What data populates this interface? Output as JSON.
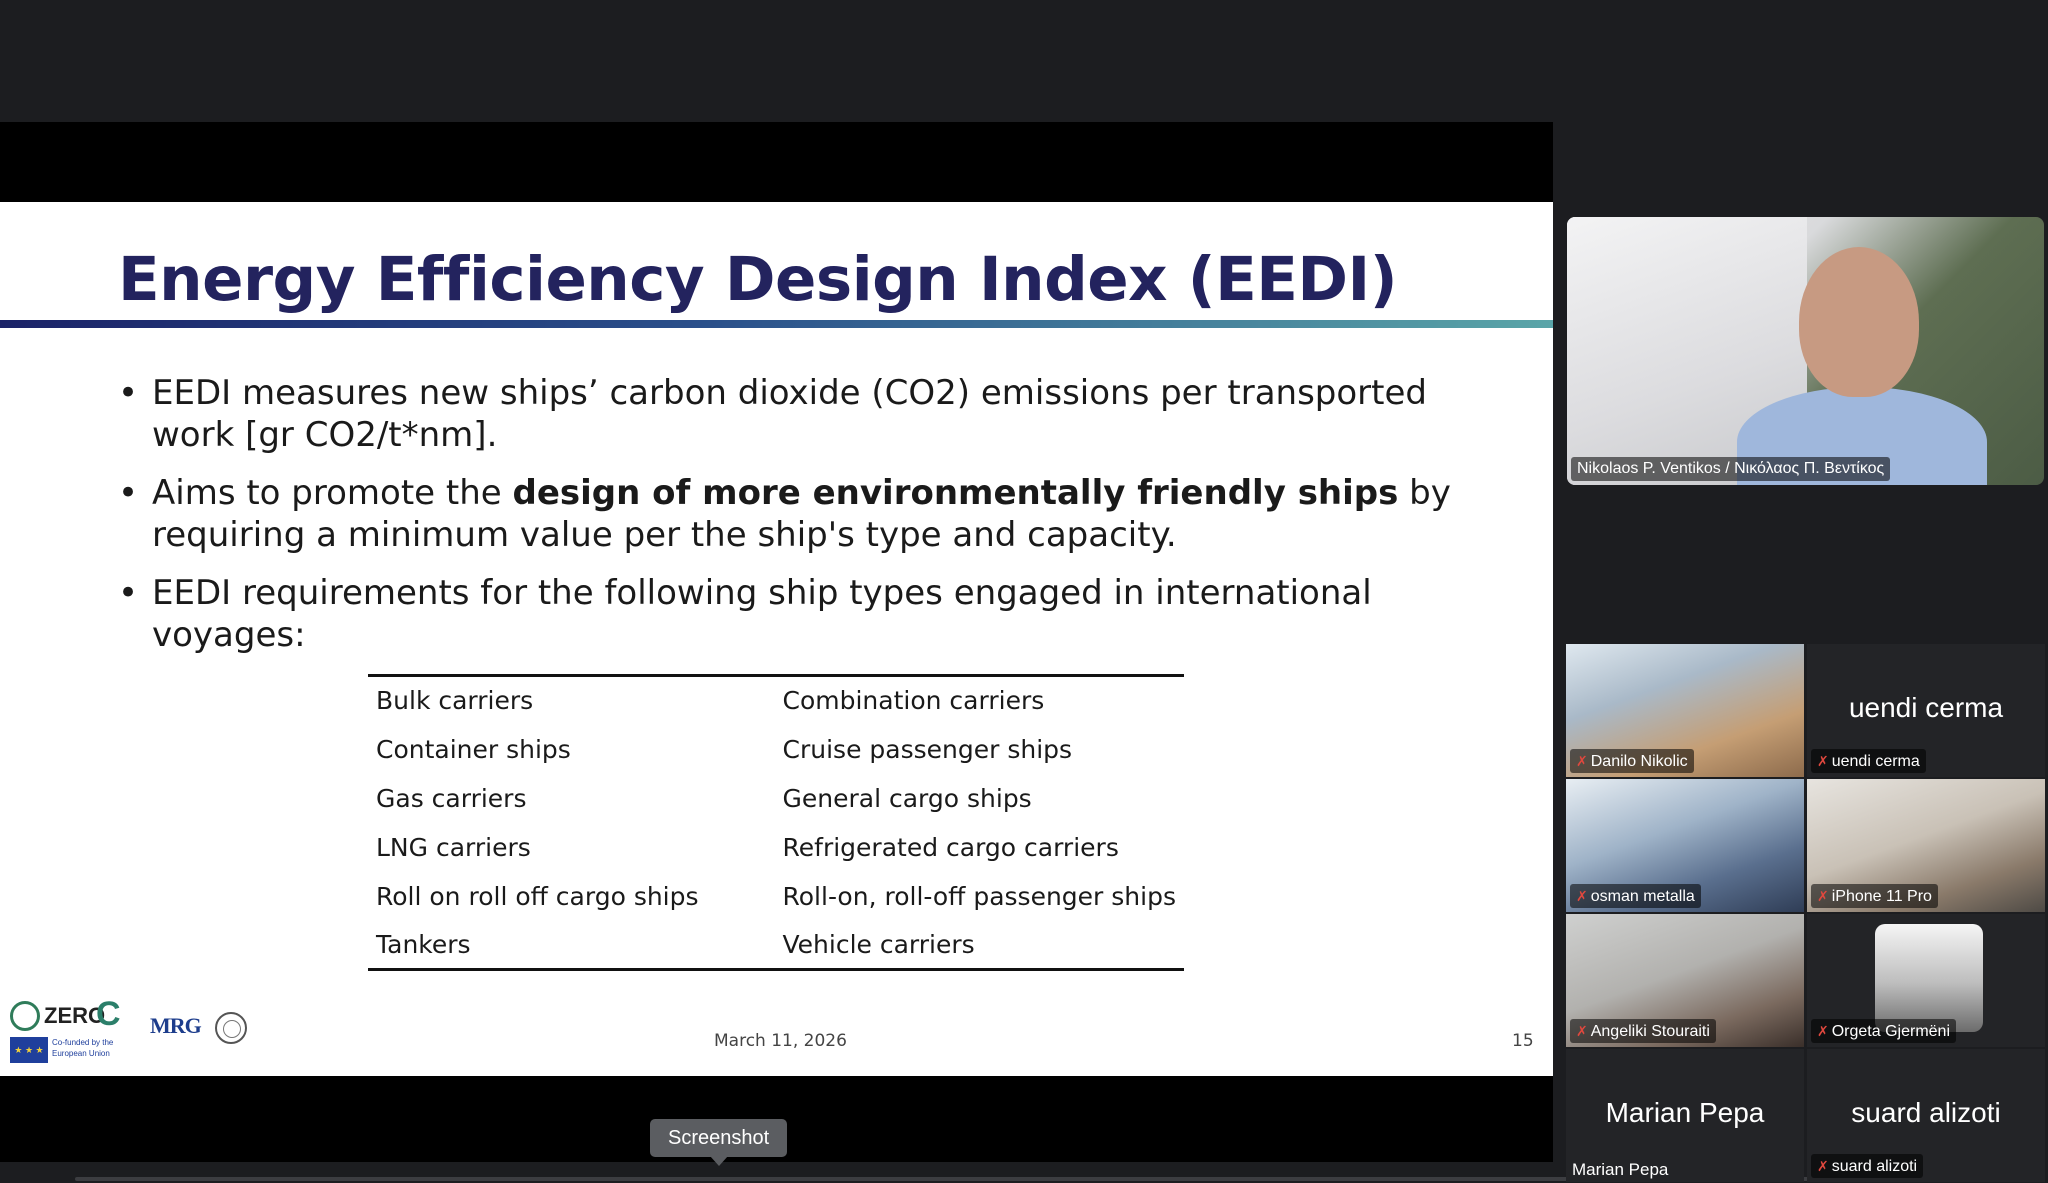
{
  "slide": {
    "title": "Energy Efficiency Design Index (EEDI)",
    "bullet1": "EEDI measures new ships’ carbon dioxide (CO2) emissions per transported work [gr CO2/t*nm].",
    "bullet2_pre": "Aims to promote the ",
    "bullet2_bold": "design of more environmentally friendly ships",
    "bullet2_post": " by requiring a minimum value per the ship's type and capacity.",
    "bullet3": "EEDI requirements for the following ship types engaged in international voyages:",
    "ship_types": [
      [
        "Bulk carriers",
        "Combination carriers"
      ],
      [
        "Container ships",
        "Cruise passenger ships"
      ],
      [
        "Gas carriers",
        "General cargo ships"
      ],
      [
        "LNG carriers",
        "Refrigerated cargo carriers"
      ],
      [
        "Roll on roll off cargo ships",
        "Roll-on, roll-off passenger ships"
      ],
      [
        "Tankers",
        "Vehicle carriers"
      ]
    ],
    "date": "March 11, 2026",
    "page_number": "15",
    "logos": {
      "zero_word": "ZERO",
      "zero_c": "C",
      "eu_text": "Co-funded by the European Union",
      "mrg": "MRG"
    }
  },
  "tooltip": {
    "label": "Screenshot"
  },
  "speaker": {
    "name": "Nikolaos P. Ventikos / Νικόλαος Π. Βεντίκος"
  },
  "participants": [
    {
      "name": "Danilo Nikolic",
      "display": "video",
      "muted": true
    },
    {
      "name": "uendi cerma",
      "display": "initials",
      "big_label": "uendi cerma",
      "muted": true
    },
    {
      "name": "osman metalla",
      "display": "video",
      "muted": true
    },
    {
      "name": "iPhone 11 Pro",
      "display": "video",
      "muted": true
    },
    {
      "name": "Angeliki Stouraiti",
      "display": "video",
      "muted": true
    },
    {
      "name": "Orgeta Gjermëni",
      "display": "avatar",
      "muted": true
    },
    {
      "name": "Marian Pepa",
      "display": "initials",
      "big_label": "Marian Pepa",
      "muted": false
    },
    {
      "name": "suard alizoti",
      "display": "initials",
      "big_label": "suard alizoti",
      "muted": true
    }
  ],
  "icons": {
    "mic_muted": "mic-muted-icon"
  }
}
